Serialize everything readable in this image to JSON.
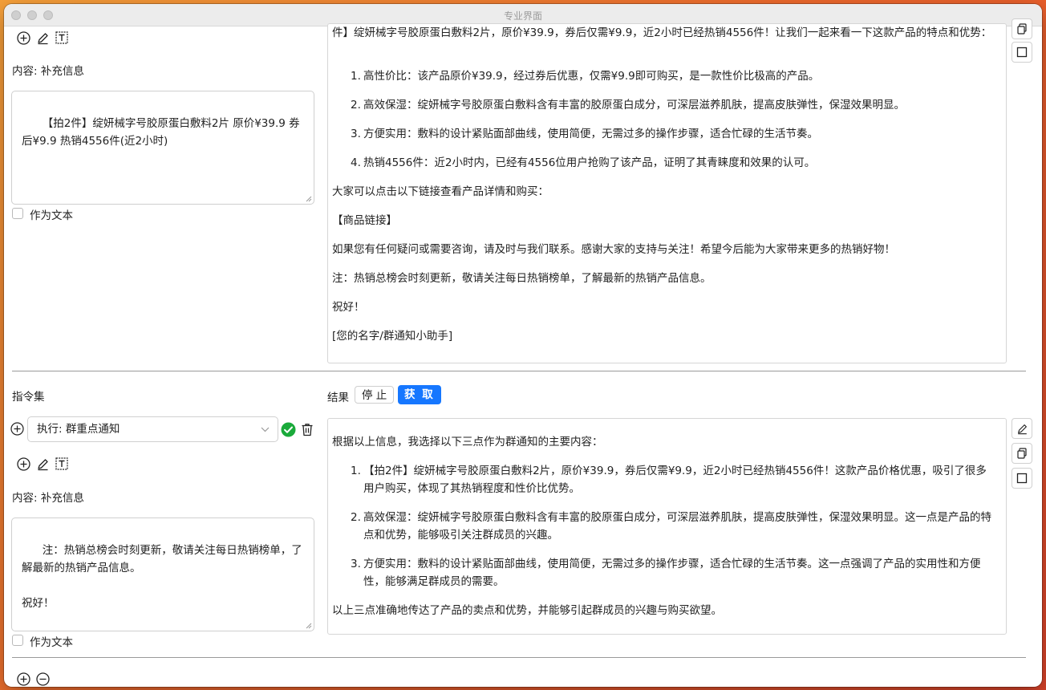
{
  "window": {
    "title": "专业界面"
  },
  "top_section": {
    "content_label": "内容: 补充信息",
    "textarea_value": "【拍2件】绽妍械字号胶原蛋白敷料2片 原价¥39.9 券后¥9.9 热销4556件(近2小时)",
    "as_text_label": "作为文本",
    "result": {
      "intro": "件】绽妍械字号胶原蛋白敷料2片，原价¥39.9，券后仅需¥9.9，近2小时已经热销4556件！让我们一起来看一下这款产品的特点和优势：",
      "list": [
        {
          "num": "1.",
          "text": "高性价比：该产品原价¥39.9，经过券后优惠，仅需¥9.9即可购买，是一款性价比极高的产品。"
        },
        {
          "num": "2.",
          "text": "高效保湿：绽妍械字号胶原蛋白敷料含有丰富的胶原蛋白成分，可深层滋养肌肤，提高皮肤弹性，保湿效果明显。"
        },
        {
          "num": "3.",
          "text": "方便实用：敷料的设计紧贴面部曲线，使用简便，无需过多的操作步骤，适合忙碌的生活节奏。"
        },
        {
          "num": "4.",
          "text": "热销4556件：近2小时内，已经有4556位用户抢购了该产品，证明了其青睐度和效果的认可。"
        }
      ],
      "p_after1": "大家可以点击以下链接查看产品详情和购买：",
      "p_link": "【商品链接】",
      "p_contact": "如果您有任何疑问或需要咨询，请及时与我们联系。感谢大家的支持与关注！希望今后能为大家带来更多的热销好物！",
      "p_note": "注：热销总榜会时刻更新，敬请关注每日热销榜单，了解最新的热销产品信息。",
      "p_greet": "祝好！",
      "p_sign": "[您的名字/群通知小助手]"
    }
  },
  "bottom_section": {
    "instruction_set_label": "指令集",
    "result_label": "结果",
    "stop_label": "停 止",
    "get_label": "获 取",
    "select_value": "执行: 群重点通知",
    "content_label": "内容: 补充信息",
    "textarea_value": "注：热销总榜会时刻更新，敬请关注每日热销榜单，了解最新的热销产品信息。\n\n祝好！\n\n[您的名字/群通知小助手]",
    "as_text_label": "作为文本",
    "result": {
      "intro": "根据以上信息，我选择以下三点作为群通知的主要内容：",
      "list": [
        {
          "num": "1.",
          "text": "【拍2件】绽妍械字号胶原蛋白敷料2片，原价¥39.9，券后仅需¥9.9，近2小时已经热销4556件！这款产品价格优惠，吸引了很多用户购买，体现了其热销程度和性价比优势。"
        },
        {
          "num": "2.",
          "text": "高效保湿：绽妍械字号胶原蛋白敷料含有丰富的胶原蛋白成分，可深层滋养肌肤，提高皮肤弹性，保湿效果明显。这一点是产品的特点和优势，能够吸引关注群成员的兴趣。"
        },
        {
          "num": "3.",
          "text": "方便实用：敷料的设计紧贴面部曲线，使用简便，无需过多的操作步骤，适合忙碌的生活节奏。这一点强调了产品的实用性和方便性，能够满足群成员的需要。"
        }
      ],
      "outro": "以上三点准确地传达了产品的卖点和优势，并能够引起群成员的兴趣与购买欲望。"
    }
  },
  "colors": {
    "accent": "#1677ff",
    "success": "#1aaa3a"
  }
}
